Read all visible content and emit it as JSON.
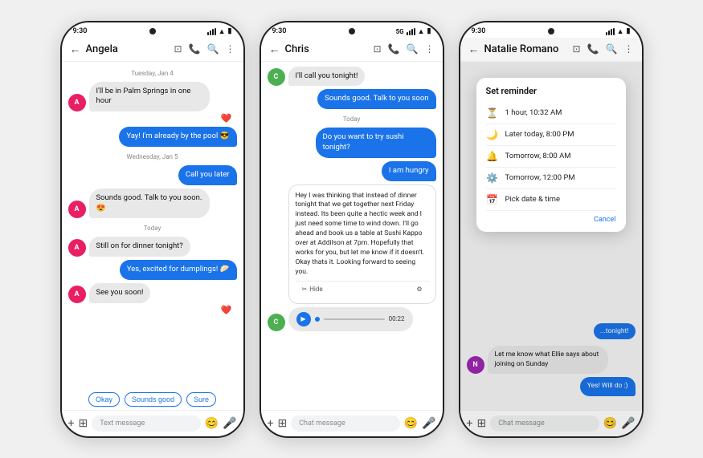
{
  "phone1": {
    "time": "9:30",
    "contact": "Angela",
    "messages": [
      {
        "type": "date",
        "text": "Tuesday, Jan 4"
      },
      {
        "type": "incoming",
        "text": "I'll be in Palm Springs in one hour",
        "avatar": "A"
      },
      {
        "type": "heart",
        "text": "❤️"
      },
      {
        "type": "outgoing",
        "text": "Yay! I'm already by the pool 😎"
      },
      {
        "type": "date",
        "text": "Wednesday, Jan 5"
      },
      {
        "type": "outgoing",
        "text": "Call you later"
      },
      {
        "type": "incoming",
        "text": "Sounds good. Talk to you soon. 😍",
        "avatar": "A"
      },
      {
        "type": "date",
        "text": "Today"
      },
      {
        "type": "incoming",
        "text": "Still on for dinner tonight?",
        "avatar": "A"
      },
      {
        "type": "outgoing",
        "text": "Yes, excited for dumplings! 🥟"
      },
      {
        "type": "incoming",
        "text": "See you soon!",
        "avatar": "A"
      },
      {
        "type": "heart2",
        "text": "❤️"
      }
    ],
    "quickReplies": [
      "Okay",
      "Sounds good",
      "Sure"
    ],
    "inputPlaceholder": "Text message"
  },
  "phone2": {
    "time": "9:30",
    "network": "5G",
    "contact": "Chris",
    "messages": [
      {
        "type": "incoming",
        "text": "I'll call you tonight!",
        "avatar": "C"
      },
      {
        "type": "outgoing",
        "text": "Sounds good. Talk to you soon"
      },
      {
        "type": "date",
        "text": "Today"
      },
      {
        "type": "outgoing",
        "text": "Do you want to try sushi tonight?"
      },
      {
        "type": "outgoing",
        "text": "I am hungry"
      },
      {
        "type": "long_incoming",
        "text": "Hey I was thinking that instead of dinner tonight that we get together next Friday instead. Its been quite a hectic week and I just need some time to wind down.  I'll go ahead and book us a table at Sushi Kappo over at Addilson at 7pm.  Hopefully that works for you, but let me know if it doesn't. Okay thats it. Looking forward to seeing you."
      },
      {
        "type": "audio",
        "duration": "00:22"
      }
    ],
    "inputPlaceholder": "Chat message"
  },
  "phone3": {
    "time": "9:30",
    "contact": "Natalie Romano",
    "reminder": {
      "title": "Set reminder",
      "options": [
        {
          "icon": "⏳",
          "label": "1 hour, 10:32 AM"
        },
        {
          "icon": "🌙",
          "label": "Later today, 8:00 PM"
        },
        {
          "icon": "🔔",
          "label": "Tomorrow, 8:00 AM"
        },
        {
          "icon": "⚙️",
          "label": "Tomorrow, 12:00 PM"
        },
        {
          "icon": "📅",
          "label": "Pick date & time"
        }
      ],
      "cancelLabel": "Cancel"
    },
    "bgMessages": [
      {
        "type": "partial_incoming",
        "text": "...tonight!"
      },
      {
        "type": "incoming",
        "text": "Let me know what Ellie says about joining on Sunday",
        "avatar": "N"
      },
      {
        "type": "outgoing",
        "text": "Yes! Will do :)"
      }
    ],
    "inputPlaceholder": "Chat message"
  },
  "icons": {
    "back": "←",
    "video": "▶",
    "phone": "📞",
    "search": "🔍",
    "more": "⋮",
    "emoji": "😊",
    "mic": "🎤",
    "plus": "+",
    "sticker": "⊕",
    "attach": "📎",
    "hide": "Hide",
    "gear": "⚙"
  }
}
